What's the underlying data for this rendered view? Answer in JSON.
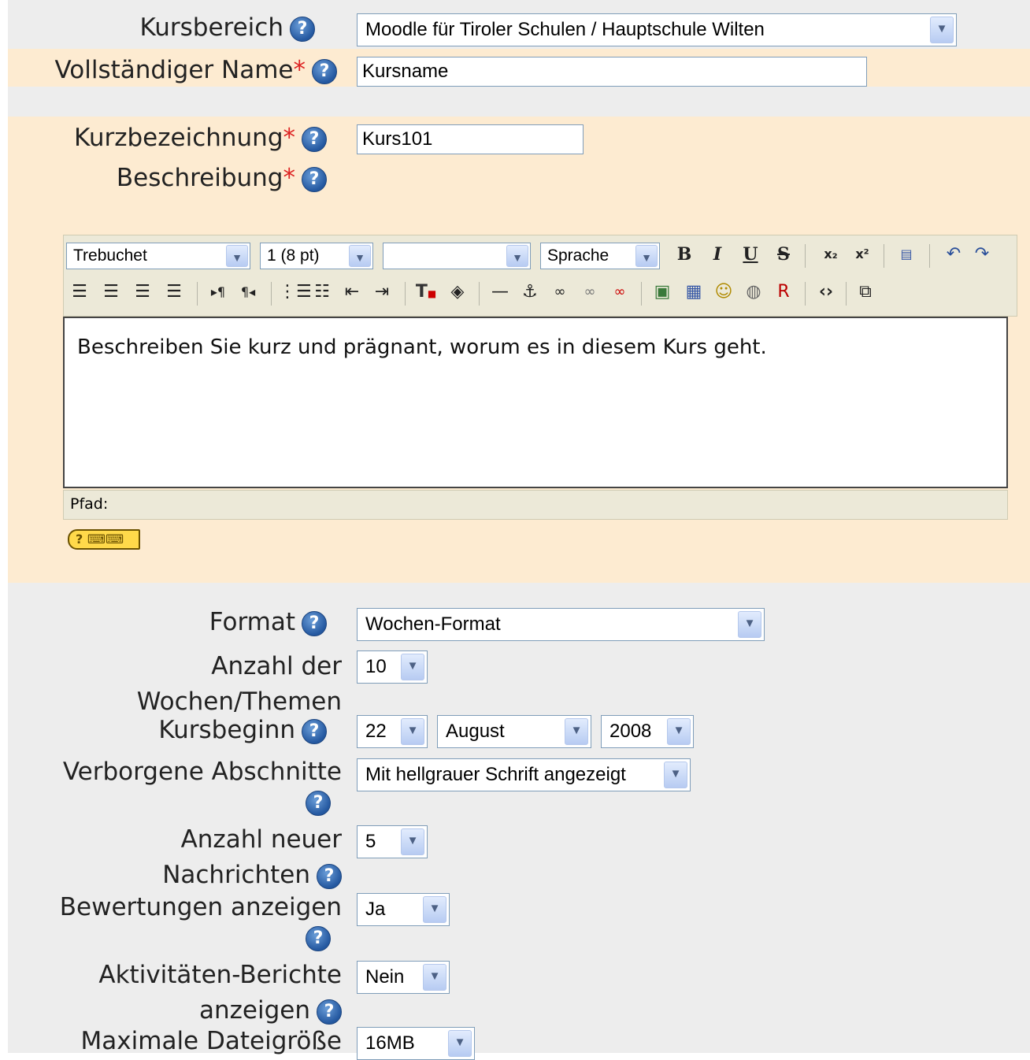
{
  "colors": {
    "band": "#fdebd1",
    "page": "#ededed",
    "required": "#dd2222",
    "help": "#2458a0"
  },
  "form": {
    "category": {
      "label": "Kursbereich",
      "value": "Moodle für Tiroler Schulen / Hauptschule Wilten"
    },
    "fullname": {
      "label": "Vollständiger Name",
      "required": "*",
      "value": "Kursname"
    },
    "shortname": {
      "label": "Kurzbezeichnung",
      "required": "*",
      "value": "Kurs101"
    },
    "summary": {
      "label": "Beschreibung",
      "required": "*"
    },
    "format": {
      "label": "Format",
      "value": "Wochen-Format"
    },
    "numsections": {
      "label": "Anzahl der Wochen/Themen",
      "value": "10"
    },
    "startdate": {
      "label": "Kursbeginn",
      "day": "22",
      "month": "August",
      "year": "2008"
    },
    "hiddensections": {
      "label": "Verborgene Abschnitte",
      "value": "Mit hellgrauer Schrift angezeigt"
    },
    "newsitems": {
      "label": "Anzahl neuer Nachrichten",
      "value": "5"
    },
    "showgrades": {
      "label": "Bewertungen anzeigen",
      "value": "Ja"
    },
    "showreports": {
      "label": "Aktivitäten-Berichte anzeigen",
      "value": "Nein"
    },
    "maxbytes": {
      "label": "Maximale Dateigröße",
      "value": "16MB"
    }
  },
  "editor": {
    "font": "Trebuchet",
    "size": "1 (8 pt)",
    "style": "",
    "language": "Sprache",
    "content": "Beschreiben Sie kurz und prägnant, worum es in diesem Kurs geht.",
    "path_label": "Pfad:",
    "icons_row1": [
      "bold-icon",
      "italic-icon",
      "underline-icon",
      "strikethrough-icon",
      "subscript-icon",
      "superscript-icon",
      "clean-word-icon",
      "undo-icon",
      "redo-icon"
    ],
    "icons_row2": [
      "align-left-icon",
      "align-center-icon",
      "align-right-icon",
      "justify-icon",
      "ltr-icon",
      "rtl-icon",
      "ordered-list-icon",
      "unordered-list-icon",
      "outdent-icon",
      "indent-icon",
      "text-color-icon",
      "background-color-icon",
      "horizontal-rule-icon",
      "anchor-icon",
      "link-icon",
      "unlink-icon",
      "nolink-icon",
      "insert-image-icon",
      "insert-table-icon",
      "smiley-icon",
      "special-chars-icon",
      "search-replace-icon",
      "html-source-icon",
      "fullscreen-icon"
    ]
  },
  "help_glyph": "?"
}
